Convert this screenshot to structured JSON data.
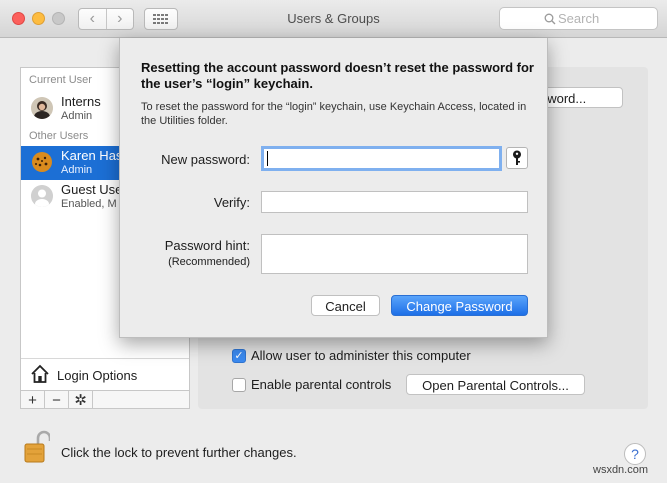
{
  "window": {
    "title": "Users & Groups",
    "search_placeholder": "Search",
    "nav_back": "‹",
    "nav_forward": "›"
  },
  "sidebar": {
    "current_user_header": "Current User",
    "current_user": {
      "name": "Interns",
      "role": "Admin"
    },
    "other_users_header": "Other Users",
    "other_users": [
      {
        "name": "Karen Has",
        "role": "Admin"
      },
      {
        "name": "Guest Use",
        "role": "Enabled, M"
      }
    ],
    "login_options": "Login Options",
    "add_label": "+",
    "remove_label": "−",
    "gear_label": "✲"
  },
  "panel": {
    "password_button": "assword...",
    "allow_admin_label": "Allow user to administer this computer",
    "allow_admin_checked": true,
    "parental_label": "Enable parental controls",
    "parental_checked": false,
    "open_parental_button": "Open Parental Controls..."
  },
  "footer": {
    "lock_text": "Click the lock to prevent further changes.",
    "help_label": "?"
  },
  "sheet": {
    "title": "Resetting the account password doesn’t reset the password for the user’s “login” keychain.",
    "description": "To reset the password for the “login” keychain, use Keychain Access, located in the Utilities folder.",
    "new_password_label": "New password:",
    "new_password_value": "",
    "verify_label": "Verify:",
    "verify_value": "",
    "hint_label": "Password hint:",
    "hint_sublabel": "(Recommended)",
    "hint_value": "",
    "cancel_button": "Cancel",
    "change_button": "Change Password"
  },
  "watermark": "wsxdn.com",
  "colors": {
    "accent": "#1c6fd5",
    "primary_button": "#1d6fe7",
    "focus_ring": "#7fb0ef"
  }
}
